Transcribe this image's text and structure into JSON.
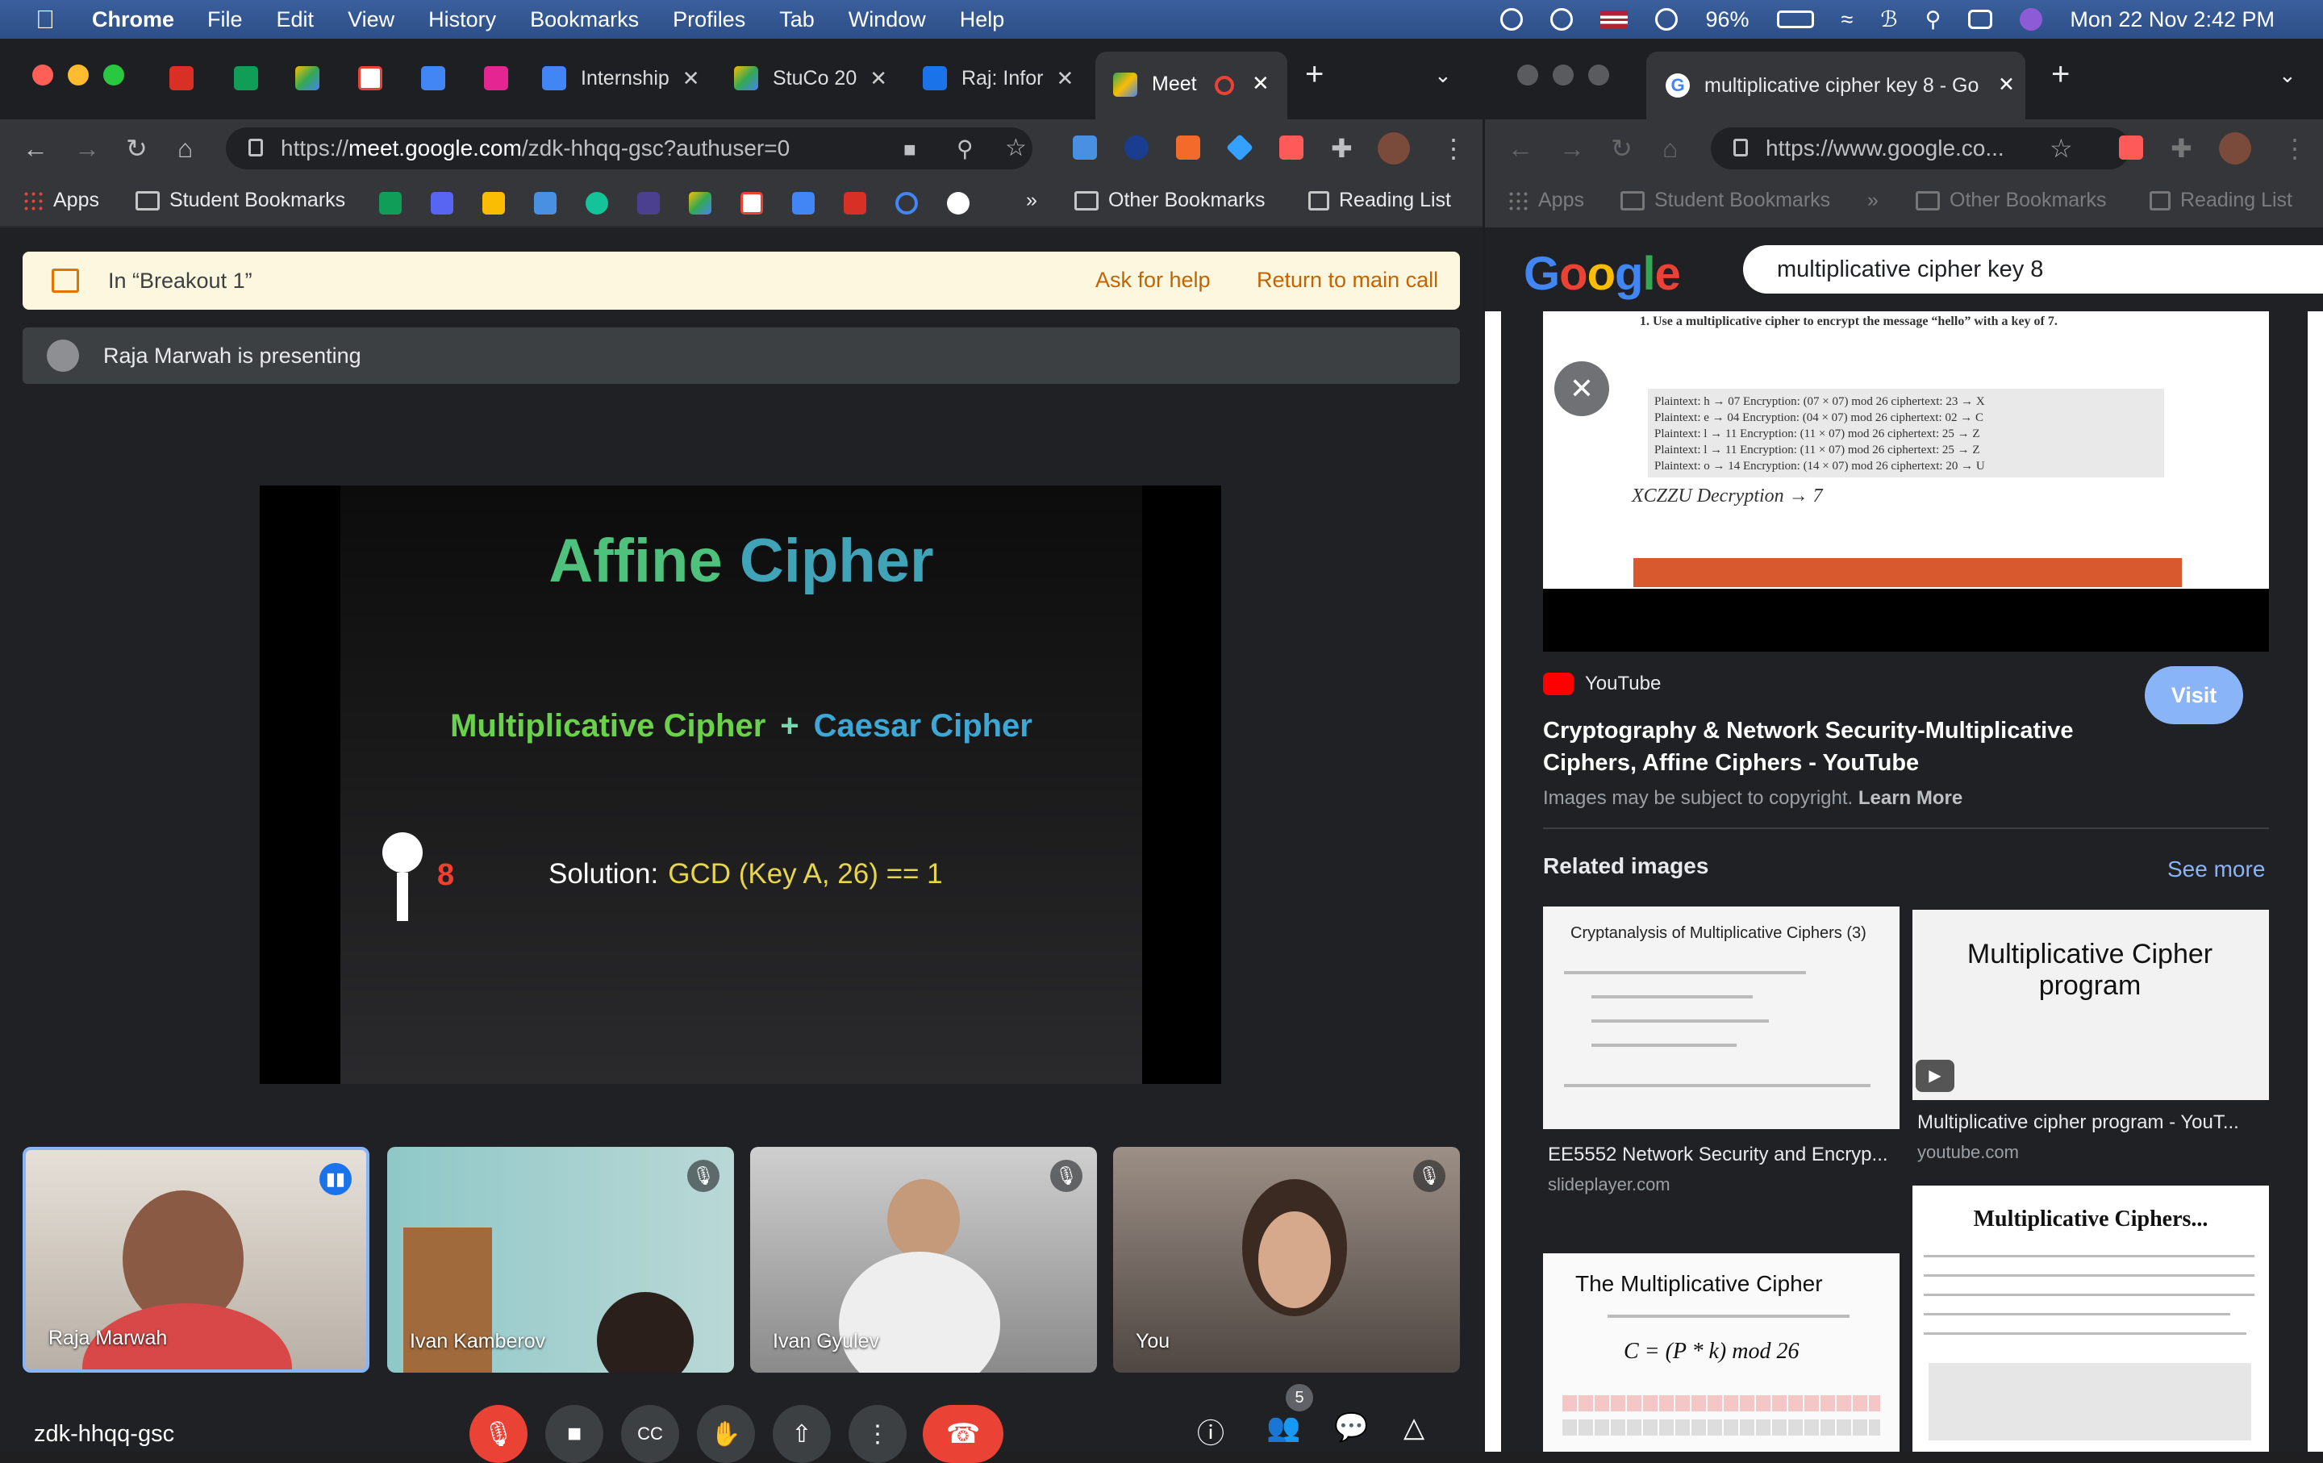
{
  "menubar": {
    "app": "Chrome",
    "items": [
      "File",
      "Edit",
      "View",
      "History",
      "Bookmarks",
      "Profiles",
      "Tab",
      "Window",
      "Help"
    ],
    "battery": "96%",
    "datetime": "Mon 22 Nov  2:42 PM"
  },
  "left_browser": {
    "tabs": [
      {
        "title": "Internship"
      },
      {
        "title": "StuCo 20"
      },
      {
        "title": "Raj: Infor"
      },
      {
        "title": "Meet"
      }
    ],
    "url_prefix": "https://",
    "url_host": "meet.google.com",
    "url_path": "/zdk-hhqq-gsc?authuser=0",
    "bookmarks": {
      "apps": "Apps",
      "student": "Student Bookmarks",
      "chevron": "»",
      "other": "Other Bookmarks",
      "reading": "Reading List"
    }
  },
  "meet": {
    "breakout_label": "In “Breakout 1”",
    "ask_help": "Ask for help",
    "return_main": "Return to main call",
    "presenting": "Raja Marwah is presenting",
    "slide": {
      "title_a": "Affine ",
      "title_b": "Cipher",
      "sub_a": "Multiplicative Cipher",
      "sub_plus": "+",
      "sub_b": "Caesar Cipher",
      "key_number": "8",
      "solution_label": "Solution:",
      "solution_formula": "GCD (Key A, 26) == 1"
    },
    "participants": [
      {
        "name": "Raja Marwah"
      },
      {
        "name": "Ivan Kamberov"
      },
      {
        "name": "Ivan Gyulev"
      },
      {
        "name": "You"
      }
    ],
    "meeting_code": "zdk-hhqq-gsc",
    "people_count": "5"
  },
  "right_browser": {
    "tab_title": "multiplicative cipher key 8 - Go",
    "url": "https://www.google.co...",
    "bookmarks": {
      "apps": "Apps",
      "student": "Student Bookmarks",
      "chevron": "»",
      "other": "Other Bookmarks",
      "reading": "Reading List"
    },
    "search_query": "multiplicative cipher key 8",
    "preview": {
      "heading": "1. Use a multiplicative cipher to encrypt the message “hello” with a key of 7.",
      "rows": [
        "Plaintext: h → 07     Encryption: (07 × 07) mod 26     ciphertext: 23 → X",
        "Plaintext: e → 04     Encryption: (04 × 07) mod 26     ciphertext: 02 → C",
        "Plaintext: l → 11     Encryption: (11 × 07) mod 26     ciphertext: 25 → Z",
        "Plaintext: l → 11     Encryption: (11 × 07) mod 26     ciphertext: 25 → Z",
        "Plaintext: o → 14     Encryption: (14 × 07) mod 26     ciphertext: 20 → U"
      ],
      "handwriting": "XCZZU    Decryption → 7"
    },
    "source": "YouTube",
    "visit": "Visit",
    "result_title": "Cryptography & Network Security-Multiplicative Ciphers, Affine Ciphers - YouTube",
    "copyright": "Images may be subject to copyright.",
    "learn_more": "Learn More",
    "related_label": "Related images",
    "see_more": "See more",
    "thumbs": [
      {
        "heading": "Cryptanalysis of Multiplicative Ciphers (3)",
        "caption": "EE5552 Network Security and Encryp...",
        "site": "slideplayer.com"
      },
      {
        "heading": "Multiplicative Cipher program",
        "caption": "Multiplicative cipher program - YouT...",
        "site": "youtube.com"
      },
      {
        "heading": "The Multiplicative Cipher",
        "formula": "C = (P * k) mod 26"
      },
      {
        "heading": "Multiplicative Ciphers..."
      }
    ]
  },
  "colors": {
    "menubar": "#2d4f88",
    "meet_bg": "#202124",
    "hangup": "#ea4335",
    "banner": "#fef7e0",
    "accent_link": "#8ab4f8"
  }
}
